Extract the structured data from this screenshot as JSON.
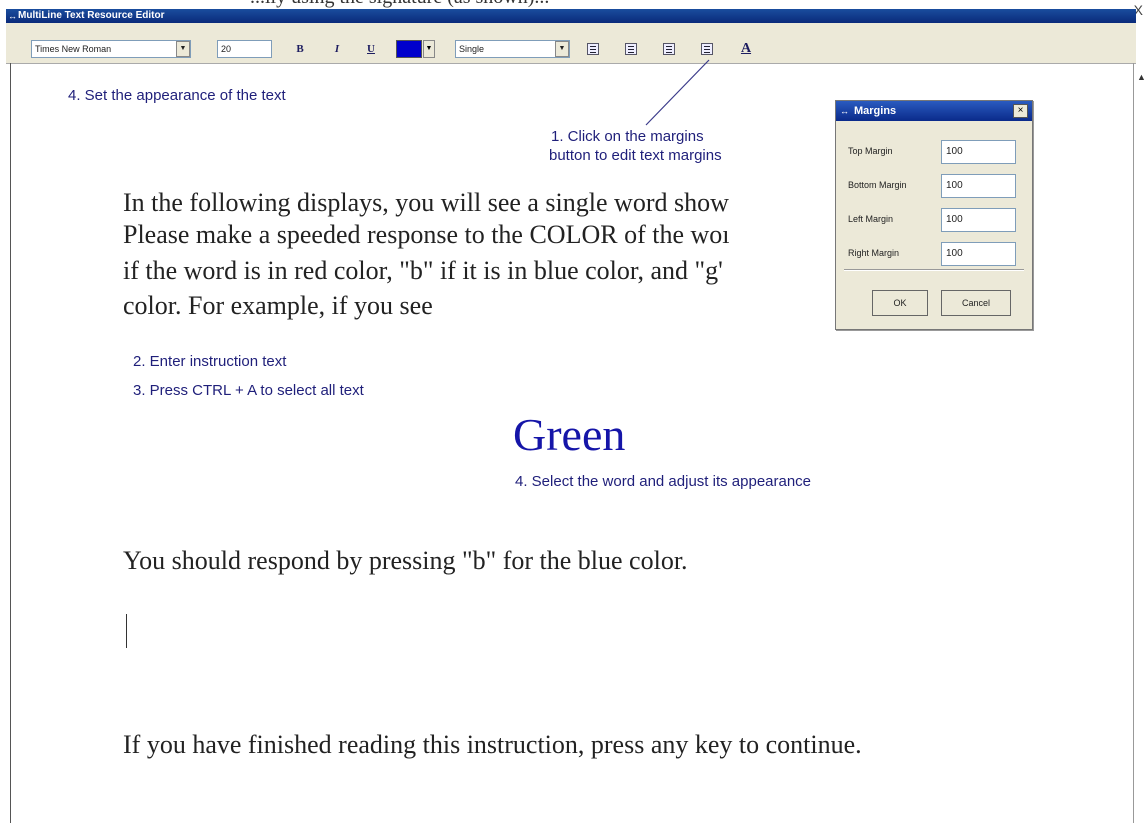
{
  "window": {
    "title": "MultiLine Text Resource Editor",
    "icon": "app-icon",
    "top_sliver": "...ily  using  the  signature  (as shown)...",
    "top_right_glyph": "X"
  },
  "toolbar": {
    "font_name": "Times New Roman",
    "font_size": "20",
    "bold_label": "B",
    "italic_label": "I",
    "underline_label": "U",
    "text_color": "#0000cc",
    "line_spacing": "Single",
    "drop_arrow": "▼",
    "text_appearance_icon": "A"
  },
  "annotations": {
    "appearance": "4. Set the appearance of the text",
    "margins_line1": "1. Click on the margins",
    "margins_line2": "button to edit text margins",
    "enter_text": "2. Enter instruction text",
    "select_all": "3. Press CTRL + A to select all text",
    "select_word": "4. Select the word and adjust its appearance"
  },
  "document": {
    "lines": [
      "In the following displays, you will see a single word show",
      "Please make a speeded response to the COLOR of the woı",
      "if the word is in red color, \"b\" if it is in blue color, and \"g'",
      "color.  For example, if you see"
    ],
    "example_word": "Green",
    "example_color": "#1515a8",
    "respond": "You should respond by pressing \"b\" for the blue color.",
    "finish": "If you have finished reading this instruction, press any key to continue."
  },
  "margins_dialog": {
    "title": "Margins",
    "close_label": "×",
    "fields": [
      {
        "label": "Top Margin",
        "value": "100"
      },
      {
        "label": "Bottom Margin",
        "value": "100"
      },
      {
        "label": "Left Margin",
        "value": "100"
      },
      {
        "label": "Right Margin",
        "value": "100"
      }
    ],
    "ok_label": "OK",
    "cancel_label": "Cancel"
  }
}
